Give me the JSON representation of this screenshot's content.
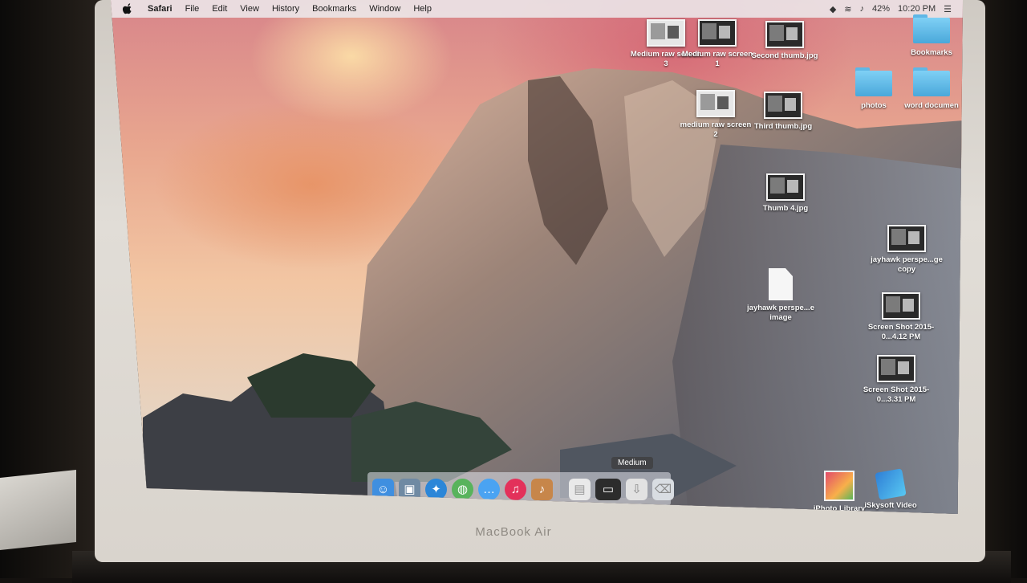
{
  "menubar": {
    "app_name": "Safari",
    "items": [
      "File",
      "Edit",
      "View",
      "History",
      "Bookmarks",
      "Window",
      "Help"
    ],
    "battery": "42%",
    "clock": "10:20 PM"
  },
  "desktop_icons": [
    {
      "label": "Medium raw screen 3",
      "kind": "screenshot"
    },
    {
      "label": "Medium raw screen 1",
      "kind": "screenshot"
    },
    {
      "label": "Second thumb.jpg",
      "kind": "image"
    },
    {
      "label": "Bookmarks",
      "kind": "folder"
    },
    {
      "label": "photos",
      "kind": "folder"
    },
    {
      "label": "word documen",
      "kind": "folder"
    },
    {
      "label": "medium raw screen 2",
      "kind": "screenshot"
    },
    {
      "label": "Third thumb.jpg",
      "kind": "image"
    },
    {
      "label": "Thumb 4.jpg",
      "kind": "image"
    },
    {
      "label": "jayhawk perspe...ge copy",
      "kind": "image"
    },
    {
      "label": "jayhawk perspe...e image",
      "kind": "document"
    },
    {
      "label": "Screen Shot 2015-0...4.12 PM",
      "kind": "screenshot"
    },
    {
      "label": "Screen Shot 2015-0...3.31 PM",
      "kind": "screenshot"
    },
    {
      "label": "iPhoto Library",
      "kind": "photo-library"
    },
    {
      "label": "iSkysoft Video",
      "kind": "application"
    }
  ],
  "dock": {
    "tooltip": "Medium",
    "apps": [
      {
        "name": "finder-icon",
        "color": "#3f8fe0"
      },
      {
        "name": "preview-icon",
        "color": "#6f8aa3"
      },
      {
        "name": "safari-icon",
        "color": "#2b86d8"
      },
      {
        "name": "maps-icon",
        "color": "#58b35c"
      },
      {
        "name": "messages-icon",
        "color": "#4aa3f2"
      },
      {
        "name": "itunes-icon",
        "color": "#e3315a"
      },
      {
        "name": "garageband-icon",
        "color": "#c7864a"
      }
    ],
    "items_right": [
      {
        "name": "documents-stack-icon",
        "color": "#e9e9e9"
      },
      {
        "name": "medium-window-icon",
        "color": "#2c2c2c"
      },
      {
        "name": "downloads-stack-icon",
        "color": "#e2e2e2"
      },
      {
        "name": "trash-icon",
        "color": "#d9dde2"
      }
    ]
  },
  "hardware": {
    "brand": "MacBook Air"
  }
}
